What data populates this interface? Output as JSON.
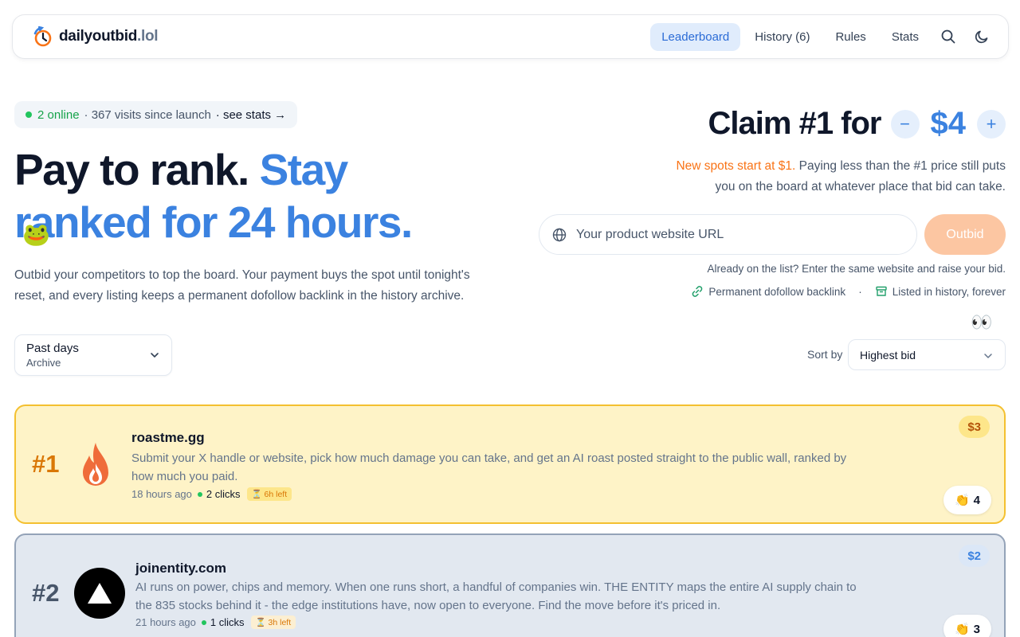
{
  "nav": {
    "brand_name": "dailyoutbid",
    "brand_tld": ".lol",
    "links": [
      "Leaderboard",
      "History (6)",
      "Rules",
      "Stats"
    ]
  },
  "hero": {
    "online_count": "2 online",
    "visits": "· 367 visits since launch",
    "see_stats": "· see stats →",
    "headline_black": "Pay to rank. ",
    "headline_blue": "Stay ranked for 24 hours.",
    "description": "Outbid your competitors to top the board. Your payment buys the spot until tonight's reset, and every listing keeps a permanent dofollow backlink in the history archive."
  },
  "claim": {
    "label": "Claim #1 for",
    "price": "$4",
    "minus": "−",
    "plus": "+",
    "desc_orange": "New spots start at $1.",
    "desc_rest": " Paying less than the #1 price still puts you on the board at whatever place that bid can take.",
    "url_placeholder": "Your product website URL",
    "button": "Outbid",
    "already": "Already on the list? Enter the same website and raise your bid.",
    "perk_backlink": "Permanent dofollow backlink",
    "perk_sep": "·",
    "perk_history": "Listed in history, forever"
  },
  "filters": {
    "past_title": "Past days",
    "past_sub": "Archive",
    "sort_label": "Sort by",
    "sort_value": "Highest bid"
  },
  "listings": [
    {
      "rank": "#1",
      "domain": "roastme.gg",
      "blurb": "Submit your X handle or website, pick how much damage you can take, and get an AI roast posted straight to the public wall, ranked by how much you paid.",
      "age": "18 hours ago",
      "clicks": "2 clicks",
      "time_left": "⏳ 6h left",
      "bid": "$3",
      "claps": "4"
    },
    {
      "rank": "#2",
      "domain": "joinentity.com",
      "blurb": "AI runs on power, chips and memory. When one runs short, a handful of companies win. THE ENTITY maps the entire AI supply chain to the 835 stocks behind it - the edge institutions have, now open to everyone. Find the move before it's priced in.",
      "age": "21 hours ago",
      "clicks": "1 clicks",
      "time_left": "⏳ 3h left",
      "bid": "$2",
      "claps": "3"
    }
  ],
  "colors": {
    "accent_blue": "#3b82e0",
    "orange": "#f97316",
    "gold_border": "#f4c030"
  }
}
